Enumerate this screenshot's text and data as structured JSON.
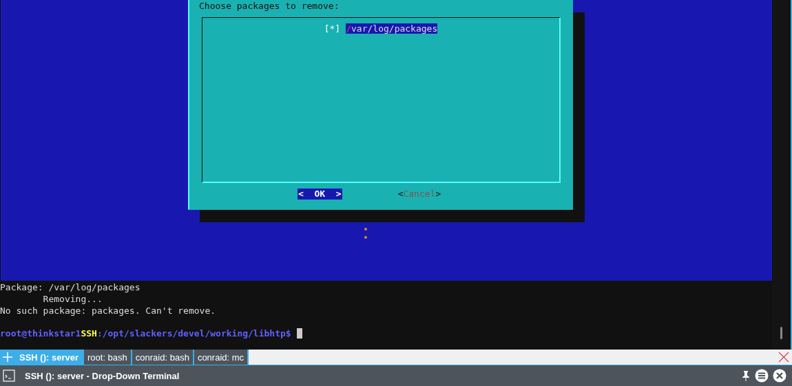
{
  "dialog": {
    "prompt": "Choose packages to remove:",
    "items": [
      {
        "checkbox": "[*]",
        "checked": true,
        "label": "/var/log/packages",
        "selected": true
      }
    ],
    "buttons": [
      {
        "open": "<  ",
        "label": "OK",
        "close": "  >",
        "selected": true
      },
      {
        "open": "<",
        "label": "Cancel",
        "close": ">",
        "selected": false
      }
    ]
  },
  "output": [
    "Package: /var/log/packages",
    "        Removing...",
    "No such package: packages. Can't remove."
  ],
  "prompt": {
    "user_host": "root@thinkstar1",
    "tag": "SSH",
    "path": ":/opt/slackers/devel/working/libhtp$"
  },
  "tabs": [
    {
      "label": "SSH (): server",
      "selected": true
    },
    {
      "label": "root: bash",
      "selected": false
    },
    {
      "label": "conraid: bash",
      "selected": false
    },
    {
      "label": "conraid: mc",
      "selected": false
    }
  ],
  "window": {
    "title": "SSH (): server - Drop-Down Terminal"
  }
}
